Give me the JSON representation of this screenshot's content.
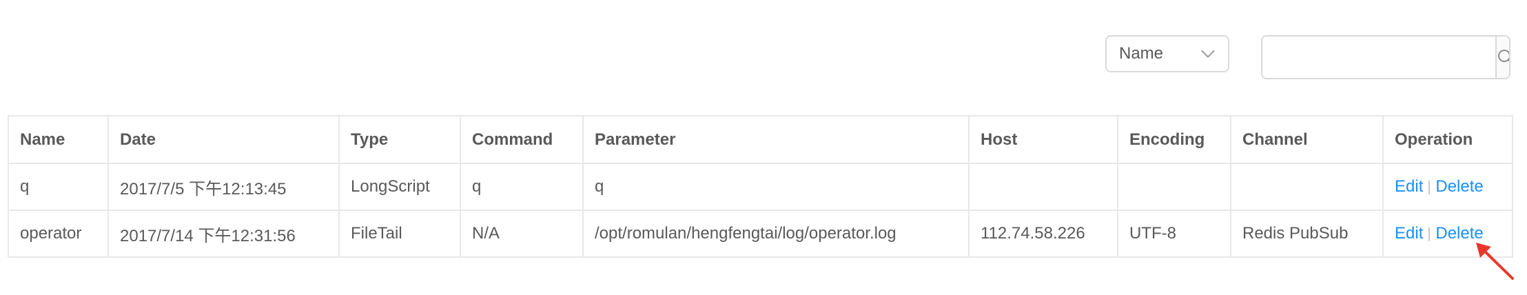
{
  "filter": {
    "selected": "Name",
    "icon": "chevron-down-icon"
  },
  "search": {
    "value": "",
    "placeholder": "",
    "icon": "search-icon"
  },
  "table": {
    "columns": [
      "Name",
      "Date",
      "Type",
      "Command",
      "Parameter",
      "Host",
      "Encoding",
      "Channel",
      "Operation"
    ],
    "rows": [
      {
        "name": "q",
        "date": "2017/7/5 下午12:13:45",
        "type": "LongScript",
        "command": "q",
        "parameter": "q",
        "host": "",
        "encoding": "",
        "channel": "",
        "edit": "Edit",
        "delete": "Delete"
      },
      {
        "name": "operator",
        "date": "2017/7/14 下午12:31:56",
        "type": "FileTail",
        "command": "N/A",
        "parameter": "/opt/romulan/hengfengtai/log/operator.log",
        "host": "112.74.58.226",
        "encoding": "UTF-8",
        "channel": "Redis PubSub",
        "edit": "Edit",
        "delete": "Delete"
      }
    ]
  },
  "annotation": {
    "icon": "red-arrow-icon",
    "color": "#e8382b"
  },
  "colors": {
    "link": "#1890ff",
    "text": "#595959",
    "border": "#e8e8e8"
  }
}
